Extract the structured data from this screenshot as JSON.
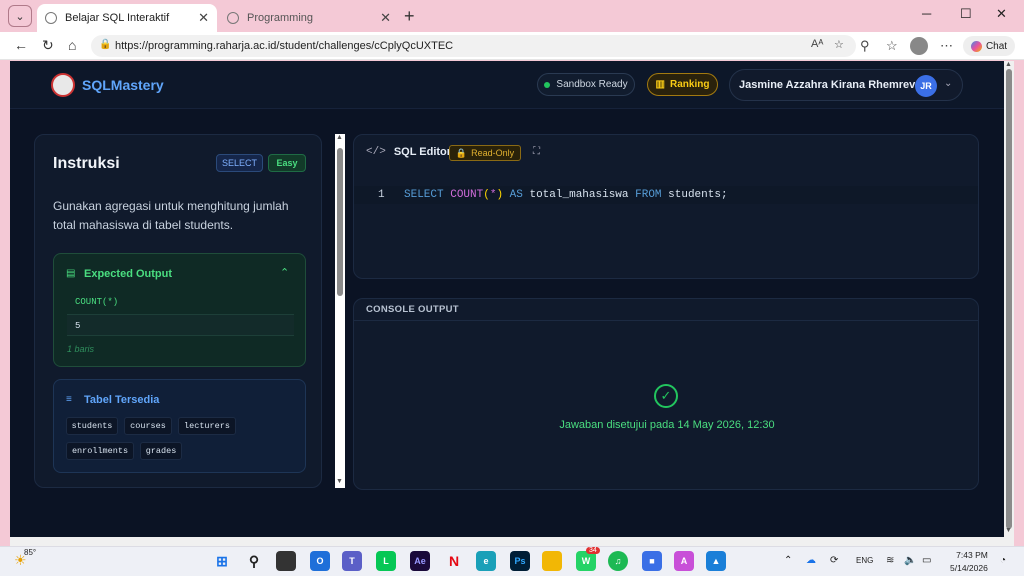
{
  "browser": {
    "tabs": [
      {
        "title": "Belajar SQL Interaktif",
        "active": true
      },
      {
        "title": "Programming",
        "active": false
      }
    ],
    "url": "https://programming.raharja.ac.id/student/challenges/cCplyQcUXTEC",
    "chat_label": "Chat",
    "icons": [
      "back-icon",
      "forward-icon",
      "refresh-icon",
      "home-icon",
      "read-aloud-icon",
      "favorite-icon",
      "extensions-icon",
      "collections-icon",
      "profile-icon",
      "more-icon"
    ]
  },
  "header": {
    "brand": "SQLMastery",
    "sandbox": "Sandbox Ready",
    "ranking": "Ranking",
    "user_name": "Jasmine Azzahra Kirana Rhemrev",
    "user_initials": "JR"
  },
  "instructions": {
    "title": "Instruksi",
    "tag_type": "SELECT",
    "tag_level": "Easy",
    "description": "Gunakan agregasi untuk menghitung jumlah total mahasiswa di tabel students."
  },
  "expected_output": {
    "title": "Expected Output",
    "column": "COUNT(*)",
    "value": "5",
    "row_count": "1 baris"
  },
  "tables": {
    "title": "Tabel Tersedia",
    "items": [
      "students",
      "courses",
      "lecturers",
      "enrollments",
      "grades"
    ]
  },
  "editor": {
    "title": "SQL Editor",
    "badge": "Read-Only",
    "line_number": "1",
    "code": {
      "select": "SELECT",
      "count": "COUNT",
      "open": "(",
      "star": "*",
      "close": ")",
      "as": "AS",
      "alias": "total_mahasiswa",
      "from": "FROM",
      "table": "students;"
    }
  },
  "console": {
    "title": "CONSOLE OUTPUT",
    "message": "Jawaban disetujui pada 14 May 2026, 12:30"
  },
  "taskbar": {
    "temperature": "85°",
    "whatsapp_badge": "34",
    "language": "ENG",
    "time": "7:43 PM",
    "date": "5/14/2026"
  },
  "colors": {
    "app_bg": "#0b1324",
    "accent_blue": "#60a5fa",
    "success_green": "#4ade80",
    "warning_gold": "#facc15"
  }
}
